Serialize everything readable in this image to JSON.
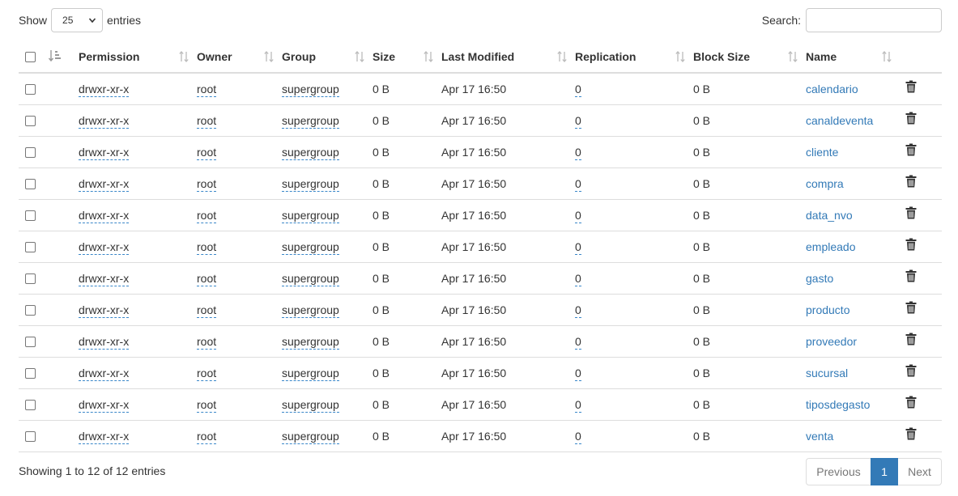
{
  "length_control": {
    "prefix": "Show",
    "selected": "25",
    "suffix": "entries"
  },
  "search": {
    "label": "Search:",
    "value": "",
    "placeholder": ""
  },
  "table": {
    "headers": {
      "permission": "Permission",
      "owner": "Owner",
      "group": "Group",
      "size": "Size",
      "last_modified": "Last Modified",
      "replication": "Replication",
      "block_size": "Block Size",
      "name": "Name"
    },
    "rows": [
      {
        "permission": "drwxr-xr-x",
        "owner": "root",
        "group": "supergroup",
        "size": "0 B",
        "last_modified": "Apr 17 16:50",
        "replication": "0",
        "block_size": "0 B",
        "name": "calendario"
      },
      {
        "permission": "drwxr-xr-x",
        "owner": "root",
        "group": "supergroup",
        "size": "0 B",
        "last_modified": "Apr 17 16:50",
        "replication": "0",
        "block_size": "0 B",
        "name": "canaldeventa"
      },
      {
        "permission": "drwxr-xr-x",
        "owner": "root",
        "group": "supergroup",
        "size": "0 B",
        "last_modified": "Apr 17 16:50",
        "replication": "0",
        "block_size": "0 B",
        "name": "cliente"
      },
      {
        "permission": "drwxr-xr-x",
        "owner": "root",
        "group": "supergroup",
        "size": "0 B",
        "last_modified": "Apr 17 16:50",
        "replication": "0",
        "block_size": "0 B",
        "name": "compra"
      },
      {
        "permission": "drwxr-xr-x",
        "owner": "root",
        "group": "supergroup",
        "size": "0 B",
        "last_modified": "Apr 17 16:50",
        "replication": "0",
        "block_size": "0 B",
        "name": "data_nvo"
      },
      {
        "permission": "drwxr-xr-x",
        "owner": "root",
        "group": "supergroup",
        "size": "0 B",
        "last_modified": "Apr 17 16:50",
        "replication": "0",
        "block_size": "0 B",
        "name": "empleado"
      },
      {
        "permission": "drwxr-xr-x",
        "owner": "root",
        "group": "supergroup",
        "size": "0 B",
        "last_modified": "Apr 17 16:50",
        "replication": "0",
        "block_size": "0 B",
        "name": "gasto"
      },
      {
        "permission": "drwxr-xr-x",
        "owner": "root",
        "group": "supergroup",
        "size": "0 B",
        "last_modified": "Apr 17 16:50",
        "replication": "0",
        "block_size": "0 B",
        "name": "producto"
      },
      {
        "permission": "drwxr-xr-x",
        "owner": "root",
        "group": "supergroup",
        "size": "0 B",
        "last_modified": "Apr 17 16:50",
        "replication": "0",
        "block_size": "0 B",
        "name": "proveedor"
      },
      {
        "permission": "drwxr-xr-x",
        "owner": "root",
        "group": "supergroup",
        "size": "0 B",
        "last_modified": "Apr 17 16:50",
        "replication": "0",
        "block_size": "0 B",
        "name": "sucursal"
      },
      {
        "permission": "drwxr-xr-x",
        "owner": "root",
        "group": "supergroup",
        "size": "0 B",
        "last_modified": "Apr 17 16:50",
        "replication": "0",
        "block_size": "0 B",
        "name": "tiposdegasto"
      },
      {
        "permission": "drwxr-xr-x",
        "owner": "root",
        "group": "supergroup",
        "size": "0 B",
        "last_modified": "Apr 17 16:50",
        "replication": "0",
        "block_size": "0 B",
        "name": "venta"
      }
    ]
  },
  "footer": {
    "info": "Showing 1 to 12 of 12 entries",
    "pagination": {
      "previous": "Previous",
      "current": "1",
      "next": "Next"
    }
  },
  "colors": {
    "link": "#337ab7",
    "active_page": "#337ab7",
    "border": "#dddddd"
  },
  "icons": {
    "row_action": "trash-icon",
    "sort": "sort-icon",
    "sort_active": "sort-amount-asc-icon"
  }
}
